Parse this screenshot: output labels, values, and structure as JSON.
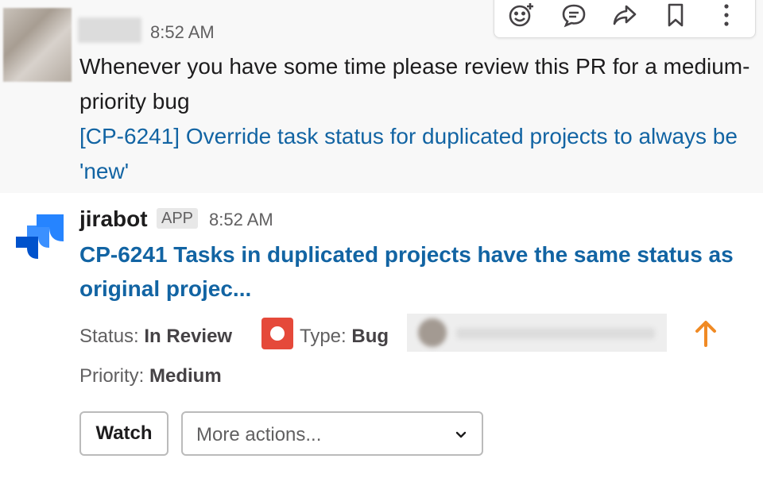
{
  "message_1": {
    "time": "8:52 AM",
    "body": "Whenever you have some time please review this PR for a medium-priority bug",
    "link_text": "[CP-6241] Override task status for duplicated projects to always be 'new'"
  },
  "toolbar": {
    "icons": [
      "add-reaction-icon",
      "reply-in-thread-icon",
      "share-message-icon",
      "save-bookmark-icon",
      "more-actions-icon"
    ]
  },
  "message_2": {
    "sender": "jirabot",
    "badge": "APP",
    "time": "8:52 AM",
    "issue_title": "CP-6241 Tasks in duplicated projects have the same status as original projec...",
    "status_label": "Status:",
    "status_value": "In Review",
    "type_label": "Type:",
    "type_value": "Bug",
    "priority_label": "Priority:",
    "priority_value": "Medium",
    "watch_button": "Watch",
    "more_actions": "More actions..."
  },
  "colors": {
    "link": "#1264a3",
    "bug": "#e5493a",
    "priority_arrow": "#f08a24",
    "jira_blue": "#2684ff"
  }
}
